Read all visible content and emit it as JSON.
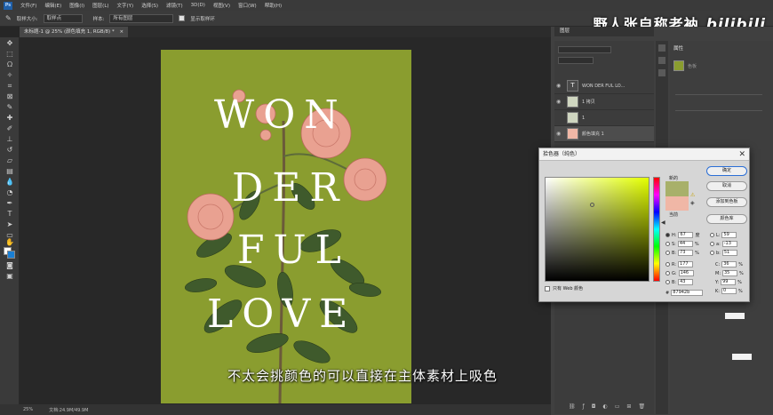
{
  "menubar": {
    "logo": "Ps",
    "items": [
      "文件(F)",
      "编辑(E)",
      "图像(I)",
      "图层(L)",
      "文字(Y)",
      "选择(S)",
      "滤镜(T)",
      "3D(D)",
      "视图(V)",
      "窗口(W)",
      "帮助(H)"
    ]
  },
  "options": {
    "sample_size_label": "取样大小:",
    "sample_size_value": "取样点",
    "sample_label": "样本:",
    "sample_value": "所有图层",
    "show_ring_label": "显示取样环"
  },
  "watermark": {
    "text": "野人张自称老衲",
    "brand": "bilibili"
  },
  "document": {
    "tab_title": "未标题-1 @ 25% (颜色填充 1, RGB/8) *",
    "artwork_lines": [
      "WON",
      "DER",
      "FUL",
      "LOVE"
    ],
    "background_color": "#8a9d2f"
  },
  "status": {
    "zoom": "25%",
    "doc_info": "文档:24.9M/49.9M"
  },
  "layers_panel": {
    "title": "图层",
    "layers": [
      {
        "name": "WON DER FUL LO...",
        "kind": "T"
      },
      {
        "name": "1 拷贝",
        "kind": "image"
      },
      {
        "name": "1",
        "kind": "image"
      },
      {
        "name": "颜色填充 1",
        "kind": "fill"
      }
    ]
  },
  "properties_panel": {
    "title": "属性",
    "subtitle": "色板"
  },
  "color_picker": {
    "title": "拾色器（纯色）",
    "new_label": "新的",
    "current_label": "当前",
    "new_color": "#a8b06a",
    "current_color": "#f0b7a6",
    "buttons": {
      "ok": "确定",
      "cancel": "取消",
      "add_swatch": "添加到色板",
      "libraries": "颜色库"
    },
    "hsb": {
      "h": "67",
      "s": "44",
      "b": "73",
      "h_unit": "度",
      "s_unit": "%",
      "b_unit": "%"
    },
    "rgb": {
      "r": "177",
      "g": "146",
      "b": "43"
    },
    "lab": {
      "l": "59",
      "a": "-13",
      "b": "51"
    },
    "cmyk": {
      "c": "36",
      "m": "35",
      "y": "99",
      "k": "0"
    },
    "cmyk_unit": "%",
    "hex": "87942b",
    "web_only_label": "只有 Web 颜色"
  },
  "subtitle": "不太会挑颜色的可以直接在主体素材上吸色"
}
